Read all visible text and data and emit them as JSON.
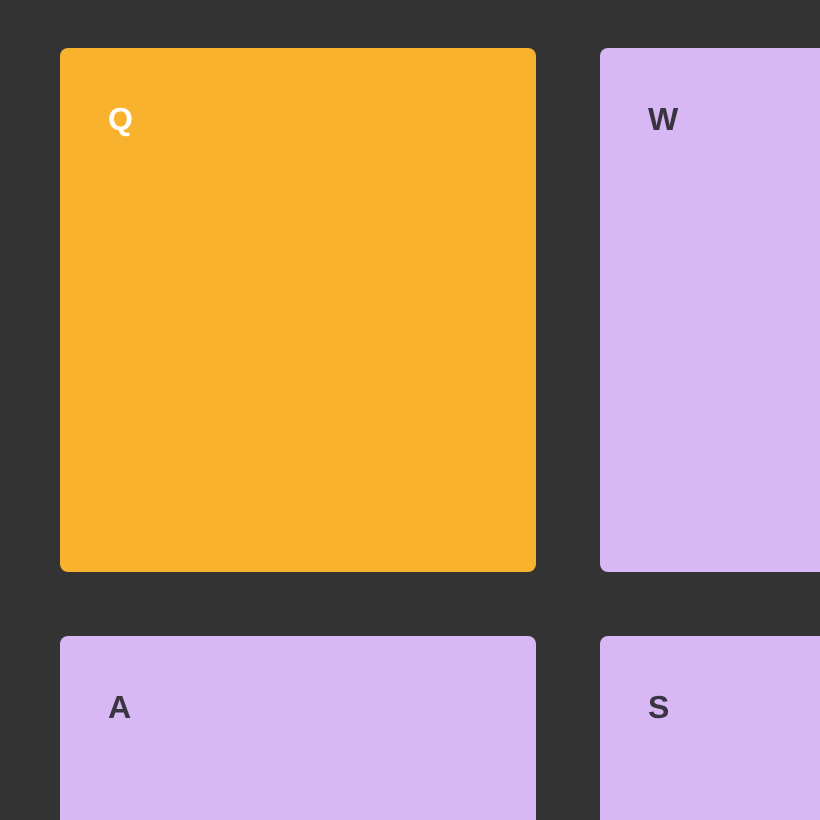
{
  "keys": [
    {
      "label": "Q",
      "selected": true
    },
    {
      "label": "W",
      "selected": false
    },
    {
      "label": "A",
      "selected": false
    },
    {
      "label": "S",
      "selected": false
    }
  ]
}
